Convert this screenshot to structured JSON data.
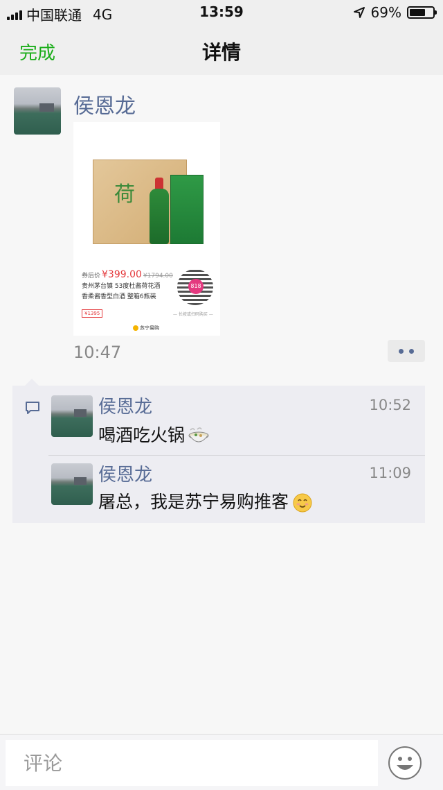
{
  "status_bar": {
    "carrier": "中国联通",
    "network": "4G",
    "time": "13:59",
    "battery_percent": "69%",
    "battery_level": 0.69
  },
  "nav": {
    "done_label": "完成",
    "title": "详情"
  },
  "post": {
    "author": "侯恩龙",
    "time": "10:47",
    "product_card": {
      "box_label": "荷",
      "price_prefix": "券后价",
      "price": "¥399.00",
      "original_price": "¥1794.00",
      "name_line1": "贵州茅台镇 53度杜酱荷花酒",
      "name_line2": "香柔酱香型白酒 整箱6瓶装",
      "tag": "¥1395",
      "qr_badge": "818",
      "qr_caption": "— 长按或扫码购买 —",
      "store_logo": "苏宁易购"
    }
  },
  "comments": [
    {
      "author": "侯恩龙",
      "time": "10:52",
      "text": "喝酒吃火锅"
    },
    {
      "author": "侯恩龙",
      "time": "11:09",
      "text": "屠总，我是苏宁易购推客"
    }
  ],
  "input_bar": {
    "placeholder": "评论"
  },
  "colors": {
    "accent_green": "#1aad19",
    "link_blue": "#576b95"
  }
}
